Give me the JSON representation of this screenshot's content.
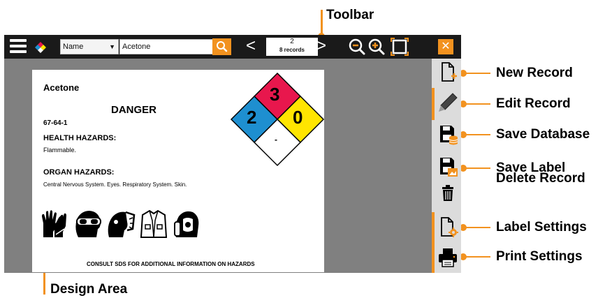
{
  "callouts": {
    "toolbar": "Toolbar",
    "new_record": "New Record",
    "edit_record": "Edit Record",
    "save_database": "Save Database",
    "save_label": "Save Label",
    "delete_record": "Delete Record",
    "label_settings": "Label Settings",
    "print_settings": "Print Settings",
    "design_area": "Design Area"
  },
  "toolbar": {
    "field_select": "Name",
    "search_value": "Acetone",
    "prev_arrow": "<",
    "next_arrow": ">",
    "record_number": "2",
    "record_total": "8 records",
    "close_symbol": "✕"
  },
  "label": {
    "product_name": "Acetone",
    "signal_word": "DANGER",
    "cas_number": "67-64-1",
    "health_hazards_heading": "HEALTH HAZARDS:",
    "health_hazards_text": "Flammable.",
    "organ_hazards_heading": "ORGAN HAZARDS:",
    "organ_hazards_text": "Central Nervous System. Eyes. Respiratory System. Skin.",
    "footer": "CONSULT SDS FOR ADDITIONAL INFORMATION ON HAZARDS",
    "nfpa": {
      "flammability": "3",
      "health": "2",
      "instability": "0",
      "special": "-",
      "colors": {
        "red": "#e8174d",
        "blue": "#1e8fd0",
        "yellow": "#ffe500",
        "white": "#ffffff"
      }
    }
  },
  "colors": {
    "accent": "#f2921f",
    "toolbar_bg": "#1a1a1a",
    "design_bg": "#808080",
    "panel_bg": "#dcdcdc"
  }
}
